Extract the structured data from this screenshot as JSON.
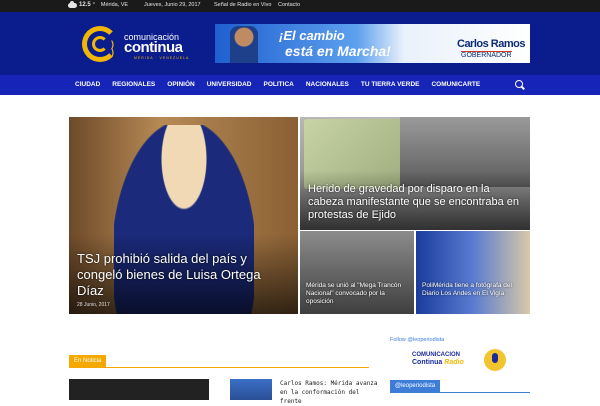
{
  "topbar": {
    "weather_icon": "cloud-icon",
    "temperature": "12.5",
    "degree": "°",
    "city": "Mérida, VE",
    "date": "Jueves, Junio 29, 2017",
    "radio_link": "Señal de Radio en Vivo",
    "contact_link": "Contacto"
  },
  "logo": {
    "line1": "comunicación",
    "line2": "continua",
    "line3": "MÉRIDA · VENEZUELA"
  },
  "banner": {
    "slogan_line1": "¡El cambio",
    "slogan_line2": "está en Marcha!",
    "candidate": "Carlos Ramos",
    "role": "GOBERNADOR"
  },
  "nav": {
    "items": [
      "CIUDAD",
      "REGIONALES",
      "OPINIÓN",
      "UNIVERSIDAD",
      "POLITICA",
      "NACIONALES",
      "TU TIERRA VERDE",
      "COMUNICARTE"
    ],
    "search_icon": "search-icon"
  },
  "featured": {
    "main": {
      "title": "TSJ prohibió salida del país y congeló bienes de Luisa Ortega Díaz",
      "date": "28 Junio, 2017"
    },
    "top": {
      "title": "Herido de gravedad por disparo en la cabeza manifestante que se encontraba en protestas de Ejido"
    },
    "bottom_left": {
      "title": "Mérida se unió al \"Mega Trancón Nacional\" convocado por la oposición"
    },
    "bottom_right": {
      "title": "PoliMérida tiene a fotógrafa del Diario Los Andes en El Vigía"
    }
  },
  "section": {
    "tag": "En Noticia",
    "news_text": "Carlos Ramos: Mérida avanza en la conformación del frente"
  },
  "sidebar": {
    "follow": "Follow @leoperiodista",
    "radio_line1": "COMUNICACION",
    "radio_line2a": "Continua ",
    "radio_line2b": "Radio",
    "handle": "@leoperiodista"
  }
}
